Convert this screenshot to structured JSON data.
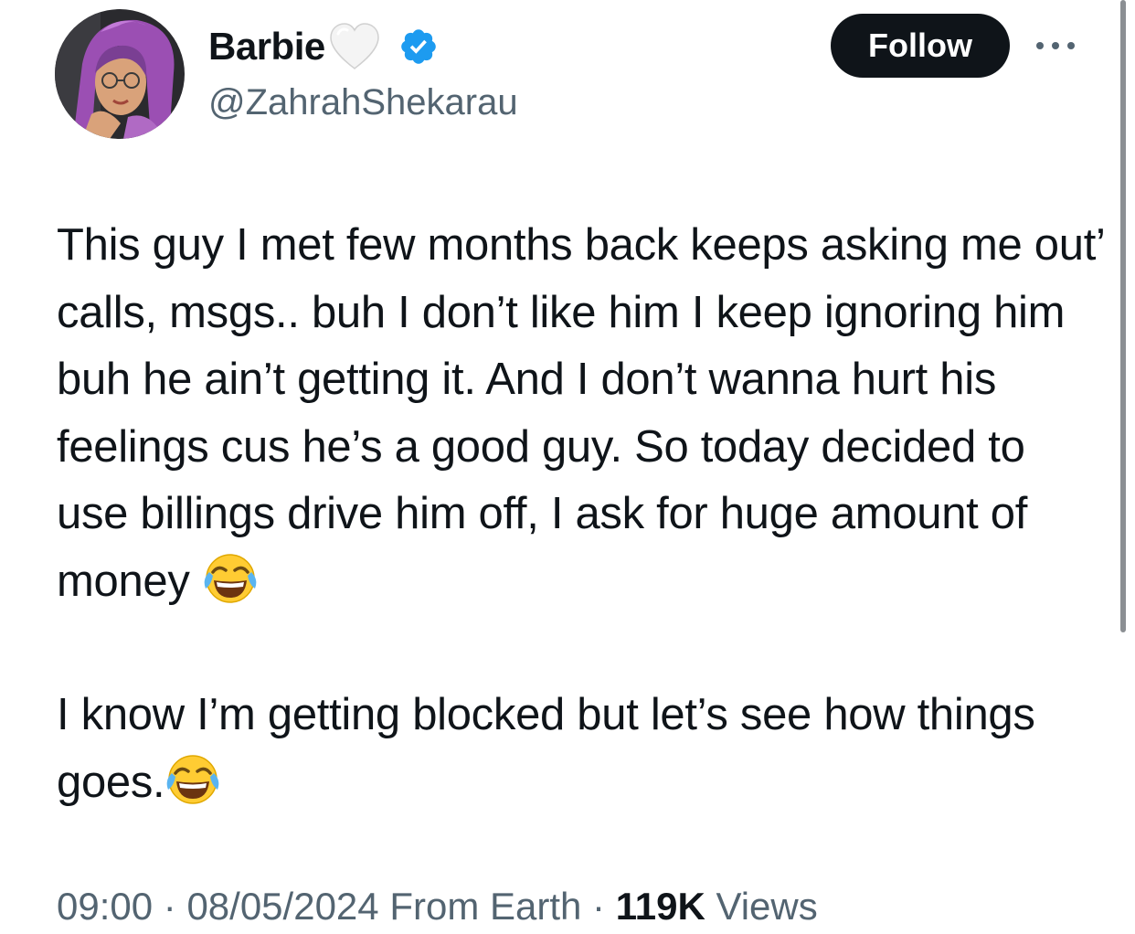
{
  "user": {
    "display_name": "Barbie",
    "handle": "@ZahrahShekarau",
    "verified": true,
    "icons": [
      "white-heart-icon",
      "verified-badge-icon"
    ]
  },
  "actions": {
    "follow_label": "Follow",
    "more_icon": "more-icon"
  },
  "tweet": {
    "paragraph_1": "This guy I met few months back keeps asking me out’ calls, msgs.. buh I don’t like him I keep ignoring him buh he ain’t getting it. And I don’t wanna hurt his feelings cus he’s a good guy. So today decided to use billings drive him off, I ask for huge amount of money ",
    "paragraph_2": "I know I’m getting blocked but let’s see how things goes.",
    "emoji": "face-with-tears-of-joy"
  },
  "meta": {
    "time": "09:00",
    "separator": " · ",
    "date": "08/05/2024",
    "source": " From Earth",
    "views_count": "119K",
    "views_label": " Views"
  },
  "colors": {
    "text": "#0f1419",
    "secondary": "#536471",
    "verified": "#1d9bf0",
    "follow_bg": "#0f1419"
  }
}
